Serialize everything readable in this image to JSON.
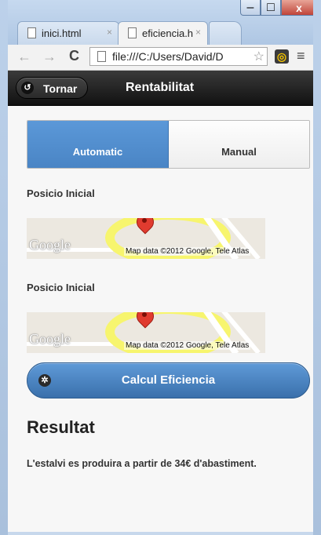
{
  "browser": {
    "tabs": [
      {
        "label": "inici.html",
        "active": false
      },
      {
        "label": "eficiencia.h",
        "active": true
      }
    ],
    "tab_close_glyph": "×",
    "address": "file:///C:/Users/David/D",
    "window_buttons": {
      "minimize": "–",
      "maximize": "□",
      "close": "x"
    },
    "icons": {
      "back": "arrow-left-icon",
      "forward": "arrow-right-icon",
      "reload": "reload-icon",
      "star": "star-icon",
      "extension": "extension-icon",
      "menu": "menu-icon"
    },
    "glyphs": {
      "back": "←",
      "forward": "→",
      "reload": "C",
      "star": "☆",
      "extension": "◎",
      "menu": "≡"
    }
  },
  "header": {
    "back_label": "Tornar",
    "back_glyph": "↺",
    "title": "Rentabilitat"
  },
  "mode": {
    "options": [
      "Automatic",
      "Manual"
    ],
    "selected": "Automatic",
    "active_color": "#4a85c5"
  },
  "positions": [
    {
      "label": "Posicio Inicial",
      "map": {
        "logo": "Google",
        "attribution": "Map data ©2012 Google, Tele Atlas"
      }
    },
    {
      "label": "Posicio Inicial",
      "map": {
        "logo": "Google",
        "attribution": "Map data ©2012 Google, Tele Atlas"
      }
    }
  ],
  "calc_button": {
    "label": "Calcul Eficiencia",
    "icon": "gear-icon",
    "glyph": "✲"
  },
  "result": {
    "title": "Resultat",
    "text": "L'estalvi es produira a partir de 34€ d'abastiment."
  }
}
